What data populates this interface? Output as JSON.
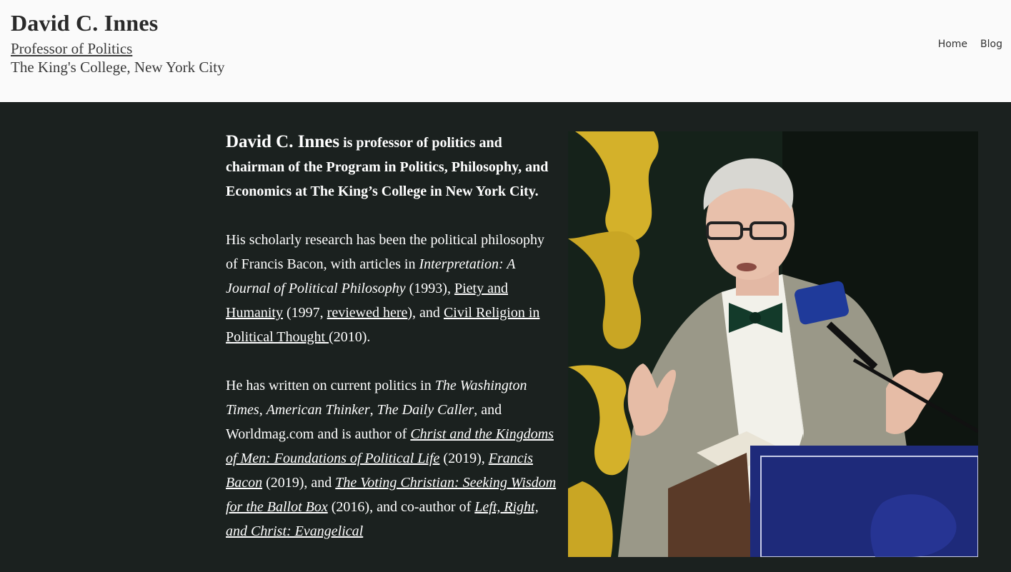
{
  "header": {
    "title": "David C. Innes",
    "subtitle_link": "Professor of Politics",
    "subtitle_location": "The King's College, New York City",
    "nav": [
      {
        "label": "Home"
      },
      {
        "label": "Blog"
      }
    ]
  },
  "bio": {
    "intro_name": "David C. Innes",
    "intro_rest": " is professor of politics and chairman of the Program in Politics, Philosophy, and Economics at The King’s College in New York City.",
    "p2": {
      "t1": "His scholarly research has been the political philosophy of Francis Bacon, with articles in ",
      "i1": "Interpretation: A Journal of Political Philosophy",
      "t2": " (1993), ",
      "link1": "Piety and Humanity",
      "t3": " (1997, ",
      "link2": "reviewed here",
      "t4": "), and ",
      "link3": "Civil Religion in Political Thought ",
      "t5": "(2010)."
    },
    "p3": {
      "t1": "He has written on current politics in ",
      "i1": "The Washington Times",
      "t2": ", ",
      "i2": "American Thinker",
      "t3": ", ",
      "i3": "The Daily Caller",
      "t4": ", and Worldmag.com and is author of ",
      "link1": "Christ and the Kingdoms of Men: Foundations of Political Life",
      "t5": " (2019), ",
      "link2": "Francis Bacon",
      "t6": " (2019), and ",
      "link3": "The Voting Christian: Seeking Wisdom for the Ballot Box",
      "t7": " (2016), and co-author of ",
      "link4": "Left, Right, and Christ: Evangelical"
    }
  },
  "colors": {
    "header_bg": "#fafafa",
    "main_bg": "#1b211f",
    "text": "#ffffff",
    "podium_blue": "#1e2a7a",
    "gold": "#d4b12a"
  }
}
